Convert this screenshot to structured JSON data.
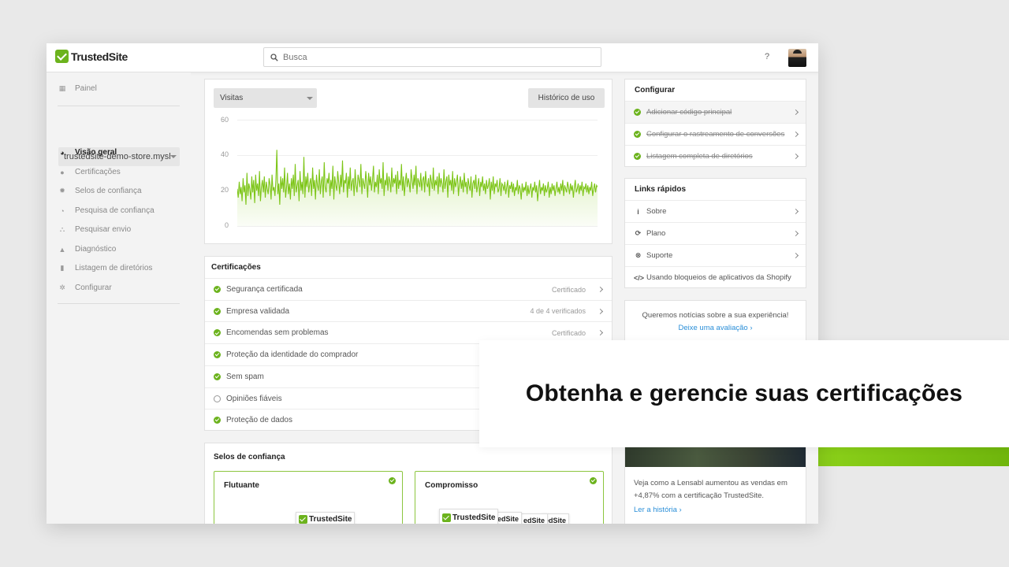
{
  "brand": {
    "name": "TrustedSite",
    "accent": "#6cb31d"
  },
  "topbar": {
    "search_placeholder": "Busca",
    "help_label": "?"
  },
  "sidebar": {
    "panel_label": "Painel",
    "store_select_value": "trustedsite-demo-store.mysl",
    "items": [
      {
        "label": "Visão geral",
        "icon": "gauge-icon",
        "active": true
      },
      {
        "label": "Certificações",
        "icon": "check-circle-icon"
      },
      {
        "label": "Selos de confiança",
        "icon": "badge-icon"
      },
      {
        "label": "Pesquisa de confiança",
        "icon": "pie-chart-icon"
      },
      {
        "label": "Pesquisar envio",
        "icon": "sitemap-icon"
      },
      {
        "label": "Diagnóstico",
        "icon": "warning-icon"
      },
      {
        "label": "Listagem de diretórios",
        "icon": "book-icon"
      },
      {
        "label": "Configurar",
        "icon": "gear-icon"
      }
    ]
  },
  "visits": {
    "metric_select": "Visitas",
    "history_button": "Histórico de uso",
    "chart_data": {
      "type": "area",
      "yticks": [
        "60",
        "40",
        "20",
        "0"
      ],
      "ylim": [
        0,
        60
      ],
      "grid": true,
      "color": "#7cc516",
      "series": [
        {
          "values": [
            21,
            16,
            25,
            18,
            22,
            14,
            27,
            19,
            23,
            12,
            30,
            17,
            24,
            21,
            15,
            28,
            19,
            26,
            13,
            29,
            20,
            24,
            17,
            31,
            14,
            22,
            26,
            19,
            28,
            16,
            25,
            21,
            18,
            27,
            23,
            15,
            29,
            20,
            22,
            17,
            26,
            43,
            18,
            24,
            12,
            28,
            21,
            27,
            19,
            33,
            16,
            22,
            30,
            18,
            24,
            15,
            27,
            21,
            29,
            17,
            35,
            19,
            23,
            26,
            14,
            31,
            20,
            25,
            18,
            39,
            16,
            28,
            22,
            30,
            19,
            24,
            27,
            17,
            33,
            21,
            26,
            15,
            29,
            23,
            20,
            32,
            18,
            25,
            28,
            16,
            36,
            22,
            19,
            27,
            24,
            30,
            17,
            26,
            21,
            34,
            15,
            28,
            23,
            20,
            31,
            25,
            18,
            29,
            22,
            37,
            19,
            26,
            24,
            30,
            16,
            28,
            21,
            33,
            20,
            25,
            27,
            17,
            32,
            23,
            19,
            29,
            26,
            22,
            35,
            18,
            27,
            24,
            21,
            31,
            25,
            16,
            30,
            23,
            28,
            20,
            26,
            34,
            19,
            25,
            22,
            29,
            18,
            32,
            24,
            27,
            21,
            36,
            17,
            26,
            23,
            30,
            20,
            28,
            25,
            19,
            33,
            22,
            27,
            24,
            29,
            18,
            31,
            21,
            26,
            23,
            35,
            20,
            28,
            17,
            25,
            30,
            22,
            27,
            24,
            19,
            32,
            26,
            21,
            29,
            23,
            34,
            18,
            27,
            25,
            22,
            30,
            20,
            26,
            28,
            19,
            31,
            24,
            22,
            27,
            17,
            29,
            25,
            21,
            33,
            20,
            26,
            23,
            28,
            18,
            30,
            22,
            27,
            24,
            19,
            32,
            21,
            25,
            28,
            16,
            29,
            23,
            26,
            20,
            31,
            18,
            27,
            22,
            25,
            29,
            17,
            24,
            28,
            21,
            26,
            19,
            30,
            22,
            25,
            18,
            27,
            23,
            20,
            28,
            16,
            24,
            26,
            21,
            29,
            19,
            23,
            27,
            17,
            25,
            22,
            28,
            20,
            24,
            18,
            26,
            21,
            23,
            27,
            15,
            25,
            20,
            28,
            18,
            24,
            22,
            26,
            19,
            21,
            27,
            17,
            24,
            23,
            20,
            25,
            18,
            22,
            26,
            16,
            23,
            21,
            25,
            19,
            24,
            17,
            22,
            20,
            26,
            18,
            23,
            21,
            15,
            24,
            19,
            22,
            20,
            25,
            17,
            23,
            18,
            21,
            24,
            16,
            22,
            20,
            25,
            19,
            23,
            14,
            21,
            26,
            18,
            22,
            20,
            24,
            17,
            23,
            19,
            21,
            25,
            16,
            22,
            18,
            24,
            20,
            23,
            17,
            21,
            25,
            19,
            22,
            18,
            24,
            20,
            26,
            17,
            23,
            21,
            19,
            25,
            22,
            18,
            24,
            20,
            23,
            16,
            22,
            26,
            19,
            21,
            24,
            18,
            23,
            20,
            25,
            17,
            22,
            21,
            24,
            19,
            23,
            18,
            22,
            20,
            25,
            17,
            21,
            24,
            19,
            23,
            22
          ]
        }
      ]
    }
  },
  "certifications": {
    "title": "Certificações",
    "rows": [
      {
        "label": "Segurança certificada",
        "status": "Certificado",
        "done": true
      },
      {
        "label": "Empresa validada",
        "status": "4 de 4 verificados",
        "done": true
      },
      {
        "label": "Encomendas sem problemas",
        "status": "Certificado",
        "done": true
      },
      {
        "label": "Proteção da identidade do comprador",
        "status": "",
        "done": true
      },
      {
        "label": "Sem spam",
        "status": "",
        "done": true
      },
      {
        "label": "Opiniões fiáveis",
        "status": "",
        "done": false
      },
      {
        "label": "Proteção de dados",
        "status": "",
        "done": true
      }
    ]
  },
  "seals": {
    "title": "Selos de confiança",
    "cards": [
      {
        "label": "Flutuante"
      },
      {
        "label": "Compromisso"
      }
    ],
    "badge_text": "TrustedSite",
    "badge_partial": "edSite"
  },
  "configure": {
    "title": "Configurar",
    "items": [
      "Adicionar código principal",
      "Configurar o rastreamento de conversões",
      "Listagem completa de diretórios"
    ]
  },
  "quick_links": {
    "title": "Links rápidos",
    "items": [
      {
        "label": "Sobre",
        "icon": "info-icon",
        "glyph": "i"
      },
      {
        "label": "Plano",
        "icon": "refresh-icon",
        "glyph": "⟳"
      },
      {
        "label": "Suporte",
        "icon": "lifebuoy-icon",
        "glyph": "⊗"
      },
      {
        "label": "Usando bloqueios de aplicativos da Shopify",
        "icon": "code-icon",
        "glyph": "</>"
      }
    ]
  },
  "feedback": {
    "text": "Queremos notícias sobre a sua experiência!",
    "link": "Deixe uma avaliação ›"
  },
  "story": {
    "text": "Veja como a Lensabl aumentou as vendas em +4,87% com a certificação TrustedSite.",
    "link": "Ler a história ›"
  },
  "overlay": {
    "headline": "Obtenha e gerencie suas certificações"
  }
}
